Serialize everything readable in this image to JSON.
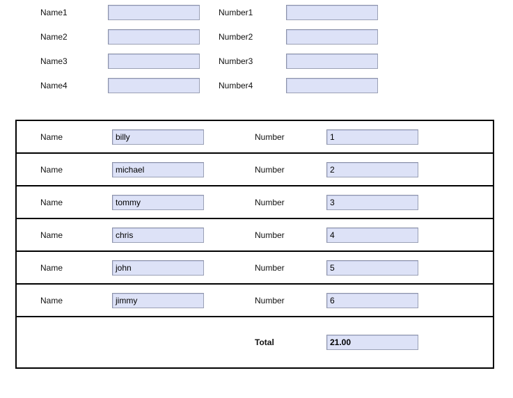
{
  "colors": {
    "field_fill": "#dde2f7",
    "field_border": "#9aa0b5",
    "table_border": "#000000",
    "text": "#000000"
  },
  "top_section": {
    "rows": [
      {
        "name_label": "Name1",
        "name_value": "",
        "number_label": "Number1",
        "number_value": ""
      },
      {
        "name_label": "Name2",
        "name_value": "",
        "number_label": "Number2",
        "number_value": ""
      },
      {
        "name_label": "Name3",
        "name_value": "",
        "number_label": "Number3",
        "number_value": ""
      },
      {
        "name_label": "Name4",
        "name_value": "",
        "number_label": "Number4",
        "number_value": ""
      }
    ]
  },
  "entries_table": {
    "rows": [
      {
        "name_label": "Name",
        "name_value": "billy",
        "number_label": "Number",
        "number_value": "1"
      },
      {
        "name_label": "Name",
        "name_value": "michael",
        "number_label": "Number",
        "number_value": "2"
      },
      {
        "name_label": "Name",
        "name_value": "tommy",
        "number_label": "Number",
        "number_value": "3"
      },
      {
        "name_label": "Name",
        "name_value": "chris",
        "number_label": "Number",
        "number_value": "4"
      },
      {
        "name_label": "Name",
        "name_value": "john",
        "number_label": "Number",
        "number_value": "5"
      },
      {
        "name_label": "Name",
        "name_value": "jimmy",
        "number_label": "Number",
        "number_value": "6"
      }
    ],
    "total": {
      "label": "Total",
      "value": "21.00"
    }
  }
}
